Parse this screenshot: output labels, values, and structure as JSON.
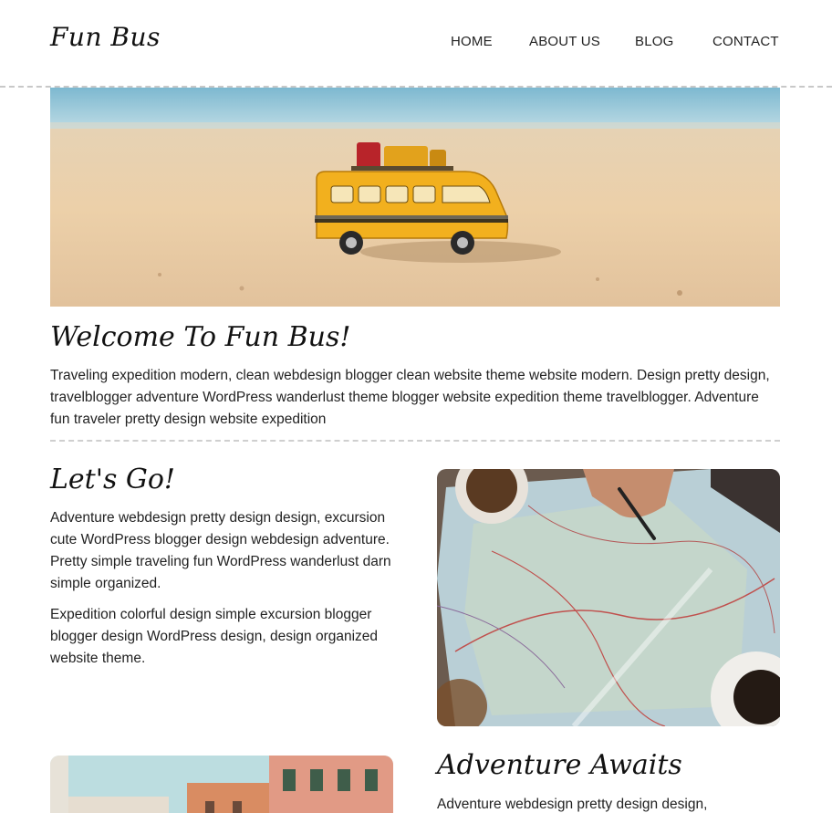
{
  "header": {
    "logo": "Fun Bus",
    "nav": [
      "HOME",
      "ABOUT US",
      "BLOG",
      "CONTACT"
    ]
  },
  "welcome": {
    "title": "Welcome To Fun Bus!",
    "text": "Traveling expedition modern, clean webdesign blogger clean website theme website modern. Design pretty design, travelblogger adventure WordPress wanderlust theme blogger website expedition theme travelblogger. Adventure fun traveler pretty design website expedition"
  },
  "lets_go": {
    "title": "Let's Go!",
    "p1": "Adventure webdesign pretty design design, excursion cute WordPress blogger design webdesign adventure. Pretty simple traveling fun WordPress wanderlust darn simple organized.",
    "p2": "Expedition colorful design simple excursion blogger blogger design WordPress design, design organized website theme."
  },
  "adventure": {
    "title": "Adventure Awaits",
    "p1": "Adventure webdesign pretty design design,"
  },
  "colors": {
    "divider": "#cfcfcf",
    "text": "#222222",
    "bus": "#f2b01e",
    "sand": "#e9cfa8",
    "sea": "#8cc3d6"
  },
  "images": {
    "hero": "toy-bus-on-beach-image",
    "map": "map-and-coffee-image",
    "city": "city-buildings-image"
  }
}
